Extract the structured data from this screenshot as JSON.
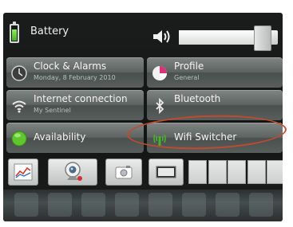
{
  "status": {
    "battery_label": "Battery",
    "volume_level_percent": 92
  },
  "tiles": [
    {
      "title": "Clock & Alarms",
      "subtitle": "Monday, 8 February 2010",
      "icon": "clock-icon"
    },
    {
      "title": "Profile",
      "subtitle": "General",
      "icon": "profile-pie-icon"
    },
    {
      "title": "Internet connection",
      "subtitle": "My Sentinel",
      "icon": "wifi-icon"
    },
    {
      "title": "Bluetooth",
      "subtitle": "",
      "icon": "bluetooth-icon"
    },
    {
      "title": "Availability",
      "subtitle": "",
      "icon": "presence-dot-icon"
    },
    {
      "title": "Wifi Switcher",
      "subtitle": "",
      "icon": "wifi-antenna-icon"
    }
  ],
  "toolbar": {
    "buttons": [
      "chart-icon",
      "webcam-icon",
      "camera-icon",
      "display-icon"
    ],
    "empty_slots": 5
  },
  "colors": {
    "accent_green": "#45b21f",
    "highlight_ring": "#c5492e",
    "tile_bg": "#5e6462"
  }
}
